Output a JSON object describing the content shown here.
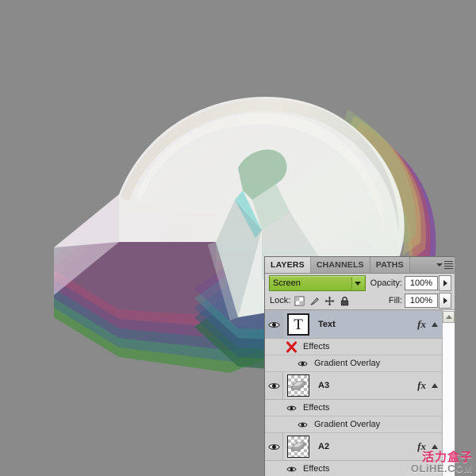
{
  "background_color": "#8a8a8a",
  "artwork": {
    "name": "isometric-3d-number-one-artwork",
    "description": "Large translucent 3D isometric numeral with stacked multicolor extrusion layers"
  },
  "panel": {
    "title": "LAYERS",
    "tabs": [
      {
        "label": "LAYERS",
        "active": true
      },
      {
        "label": "CHANNELS",
        "active": false
      },
      {
        "label": "PATHS",
        "active": false
      }
    ],
    "menu_icon": "panel-menu-icon",
    "blend_mode": {
      "value": "Screen",
      "accent_color": "#8cbe38"
    },
    "opacity": {
      "label": "Opacity:",
      "value": "100%"
    },
    "fill": {
      "label": "Fill:",
      "value": "100%"
    },
    "lock": {
      "label": "Lock:",
      "icons": [
        "lock-transparent-pixels-icon",
        "lock-image-pixels-icon",
        "lock-position-icon",
        "lock-all-icon"
      ]
    },
    "layers": [
      {
        "name": "Text",
        "thumb_type": "text",
        "thumb_glyph": "T",
        "selected": true,
        "visible": true,
        "has_fx": true,
        "effects_label": "Effects",
        "effects_visible": false,
        "sub_effects": [
          {
            "label": "Gradient Overlay",
            "visible": true
          }
        ]
      },
      {
        "name": "A3",
        "thumb_type": "checker",
        "thumb_glyph": "",
        "selected": false,
        "visible": true,
        "has_fx": true,
        "effects_label": "Effects",
        "effects_visible": true,
        "sub_effects": [
          {
            "label": "Gradient Overlay",
            "visible": true
          }
        ]
      },
      {
        "name": "A2",
        "thumb_type": "checker",
        "thumb_glyph": "",
        "selected": false,
        "visible": true,
        "has_fx": true,
        "effects_label": "Effects",
        "effects_visible": true,
        "sub_effects": []
      }
    ]
  },
  "watermark": {
    "cn": "活力盒子",
    "en": "OLiHE.COM",
    "cn_color": "#e0326e"
  }
}
